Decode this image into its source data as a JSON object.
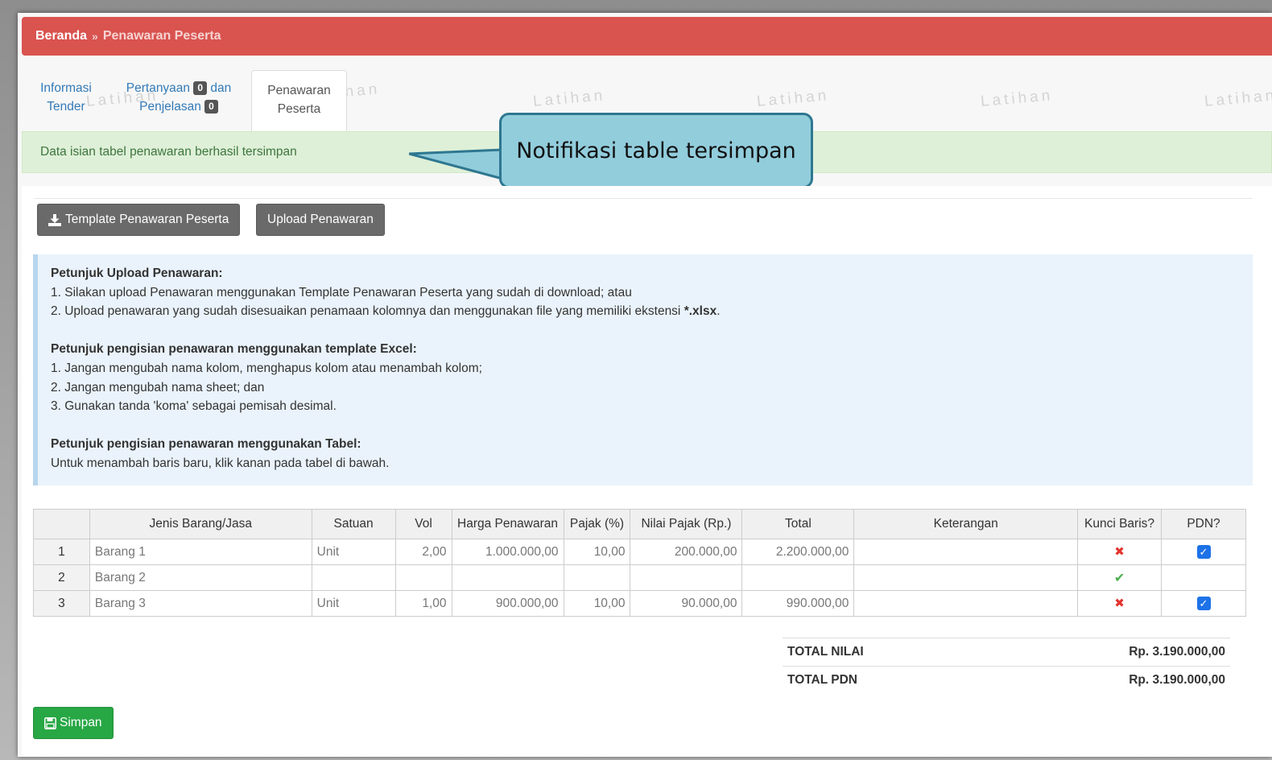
{
  "breadcrumb": {
    "home": "Beranda",
    "separator": "»",
    "current": "Penawaran Peserta"
  },
  "watermark": "Latihan",
  "tabs": {
    "info_line1": "Informasi",
    "info_line2": "Tender",
    "qa_line1": "Pertanyaan",
    "qa_badge1": "0",
    "qa_and": "dan",
    "qa_line2": "Penjelasan",
    "qa_badge2": "0",
    "active_line1": "Penawaran",
    "active_line2": "Peserta"
  },
  "alert": {
    "text": "Data isian tabel penawaran berhasil tersimpan"
  },
  "callout": {
    "text": "Notifikasi table tersimpan"
  },
  "buttons": {
    "template": "Template Penawaran Peserta",
    "upload": "Upload Penawaran",
    "save": "Simpan"
  },
  "instructions": {
    "upload_title": "Petunjuk Upload Penawaran:",
    "upload_1": "1. Silakan upload Penawaran menggunakan Template Penawaran Peserta yang sudah di download; atau",
    "upload_2_prefix": "2. Upload penawaran yang sudah disesuaikan penamaan kolomnya dan menggunakan file yang memiliki ekstensi ",
    "upload_2_ext": "*.xlsx",
    "upload_2_suffix": ".",
    "excel_title": "Petunjuk pengisian penawaran menggunakan template Excel:",
    "excel_1": "1. Jangan mengubah nama kolom, menghapus kolom atau menambah kolom;",
    "excel_2": "2. Jangan mengubah nama sheet; dan",
    "excel_3": "3. Gunakan tanda 'koma' sebagai pemisah desimal.",
    "table_title": "Petunjuk pengisian penawaran menggunakan Tabel:",
    "table_1": "Untuk menambah baris baru, klik kanan pada tabel di bawah."
  },
  "table": {
    "headers": [
      "",
      "Jenis Barang/Jasa",
      "Satuan",
      "Vol",
      "Harga Penawaran",
      "Pajak (%)",
      "Nilai Pajak (Rp.)",
      "Total",
      "Keterangan",
      "Kunci Baris?",
      "PDN?"
    ],
    "rows": [
      {
        "no": "1",
        "item": "Barang 1",
        "unit": "Unit",
        "vol": "2,00",
        "price": "1.000.000,00",
        "tax": "10,00",
        "tax_value": "200.000,00",
        "total": "2.200.000,00",
        "note": "",
        "locked": false,
        "pdn": true
      },
      {
        "no": "2",
        "item": "Barang 2",
        "unit": "",
        "vol": "",
        "price": "",
        "tax": "",
        "tax_value": "",
        "total": "",
        "note": "",
        "locked": true,
        "pdn": false
      },
      {
        "no": "3",
        "item": "Barang 3",
        "unit": "Unit",
        "vol": "1,00",
        "price": "900.000,00",
        "tax": "10,00",
        "tax_value": "90.000,00",
        "total": "990.000,00",
        "note": "",
        "locked": false,
        "pdn": true
      }
    ]
  },
  "totals": {
    "nilai_label": "TOTAL NILAI",
    "nilai_value": "Rp. 3.190.000,00",
    "pdn_label": "TOTAL PDN",
    "pdn_value": "Rp. 3.190.000,00"
  },
  "icons": {
    "download": "download-icon",
    "save": "floppy-icon",
    "unlocked": "x-mark-icon",
    "locked": "check-mark-icon",
    "checkbox": "checkbox-checked-icon"
  },
  "colors": {
    "breadcrumb_bg": "#d9534f",
    "alert_bg": "#dff0d8",
    "alert_text": "#3c763d",
    "callout_bg": "#92cddc",
    "callout_border": "#2e7790",
    "button_gray": "#6a6a6a",
    "button_green": "#28a745",
    "info_bg": "#eaf3fb"
  }
}
